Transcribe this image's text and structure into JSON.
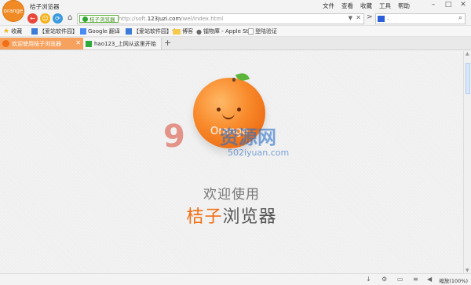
{
  "app": {
    "logo_text": "orange",
    "title": "桔子浏览器"
  },
  "menu": [
    "文件",
    "查看",
    "收藏",
    "工具",
    "帮助"
  ],
  "window_controls": {
    "minimize": "–",
    "maximize": "□",
    "close": "✕"
  },
  "nav": {
    "back": "←",
    "forward": "☺",
    "refresh": "⟳",
    "home": "⌂",
    "cert_label": "桔子浏览器",
    "url_prefix": "http://soft.",
    "url_host": "123juzi.com",
    "url_path": "/wel/index.html",
    "go": ">",
    "search_value": "."
  },
  "bookmarks": {
    "star_label": "收藏",
    "items": [
      "【爱站软件园】",
      "Google 翻译",
      "【爱站软件园】专",
      "博客",
      "镭物庫 - Apple St",
      "登陆验证"
    ]
  },
  "tabs": [
    {
      "label": "欢迎使用桔子浏览器",
      "active": true
    },
    {
      "label": "hao123_上网从这里开始",
      "active": false
    }
  ],
  "content": {
    "orange_label": "Orange",
    "watermark_big": "9",
    "watermark_cn": "资源网",
    "watermark_url": "502iyuan.com",
    "welcome": "欢迎使用",
    "brand_hl": "桔子",
    "brand_rest": "浏览器"
  },
  "status": {
    "zoom": "缩放(100%)"
  },
  "colors": {
    "accent": "#f06e14",
    "tab_active": "#f6a25e"
  }
}
